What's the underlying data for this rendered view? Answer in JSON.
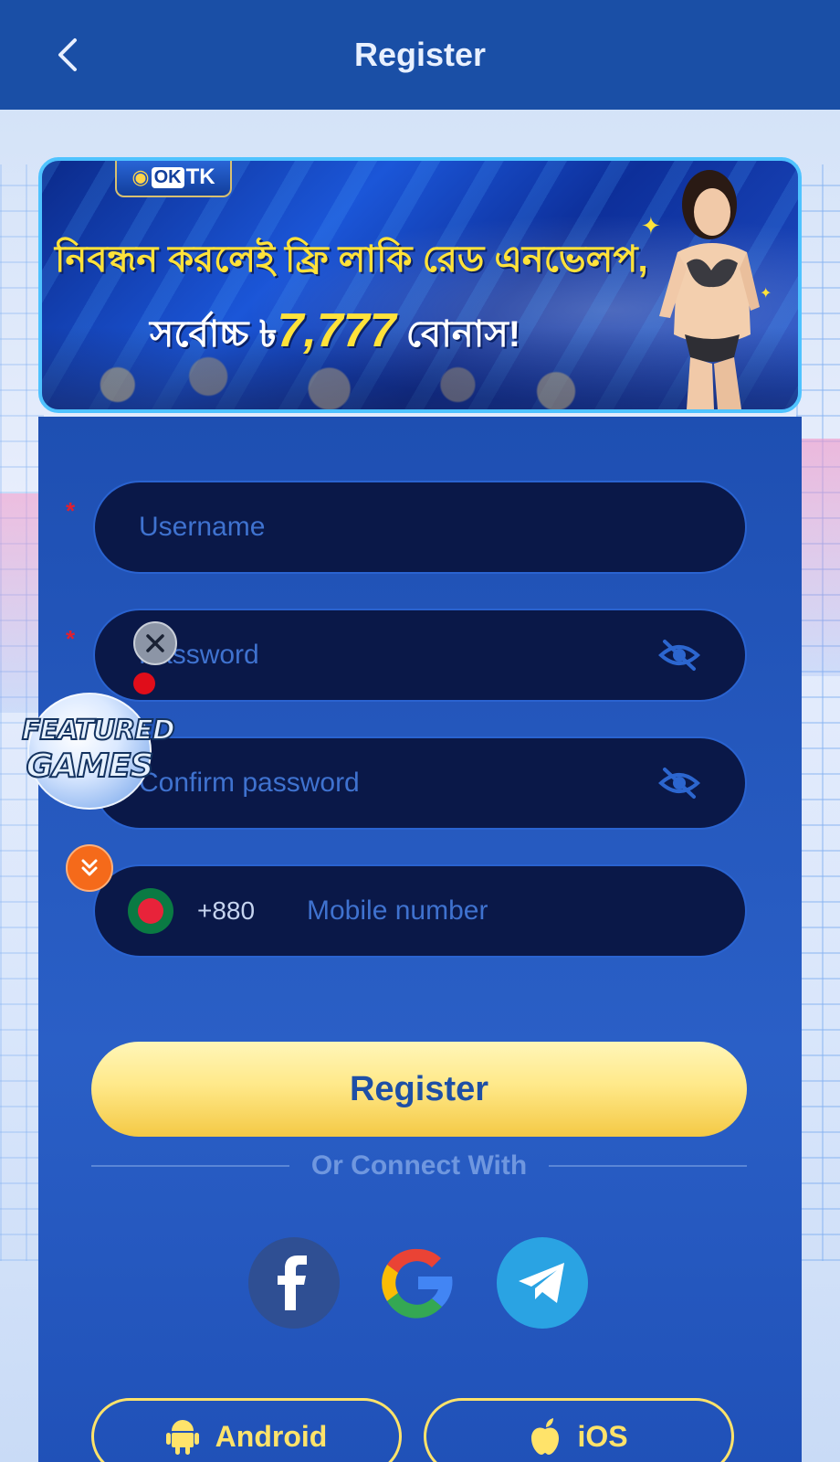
{
  "header": {
    "title": "Register",
    "back_icon": "chevron-left-icon"
  },
  "banner": {
    "logo_prefix": "OK",
    "logo_suffix": "TK",
    "line1": "নিবন্ধন করলেই ফ্রি লাকি রেড এনভেলপ,",
    "line2_before": "সর্বোচ্চ ৳",
    "line2_amount": "7,777",
    "line2_after": " বোনাস!"
  },
  "form": {
    "username_placeholder": "Username",
    "password_placeholder": "Password",
    "confirm_placeholder": "Confirm password",
    "country_code": "+880",
    "mobile_placeholder": "Mobile number",
    "required_mark": "*",
    "register_label": "Register"
  },
  "social": {
    "divider_text": "Or Connect With",
    "items": [
      "facebook-icon",
      "google-icon",
      "telegram-icon"
    ]
  },
  "downloads": {
    "android_label": "Android",
    "ios_label": "iOS"
  },
  "floating": {
    "featured_line1": "FEATURED",
    "featured_line2": "GAMES"
  },
  "colors": {
    "header_bg": "#1a4fa6",
    "panel_bg": "#2a5fc6",
    "field_bg": "#0a1848",
    "accent_yellow": "#ffe36a",
    "required_red": "#e02030"
  }
}
